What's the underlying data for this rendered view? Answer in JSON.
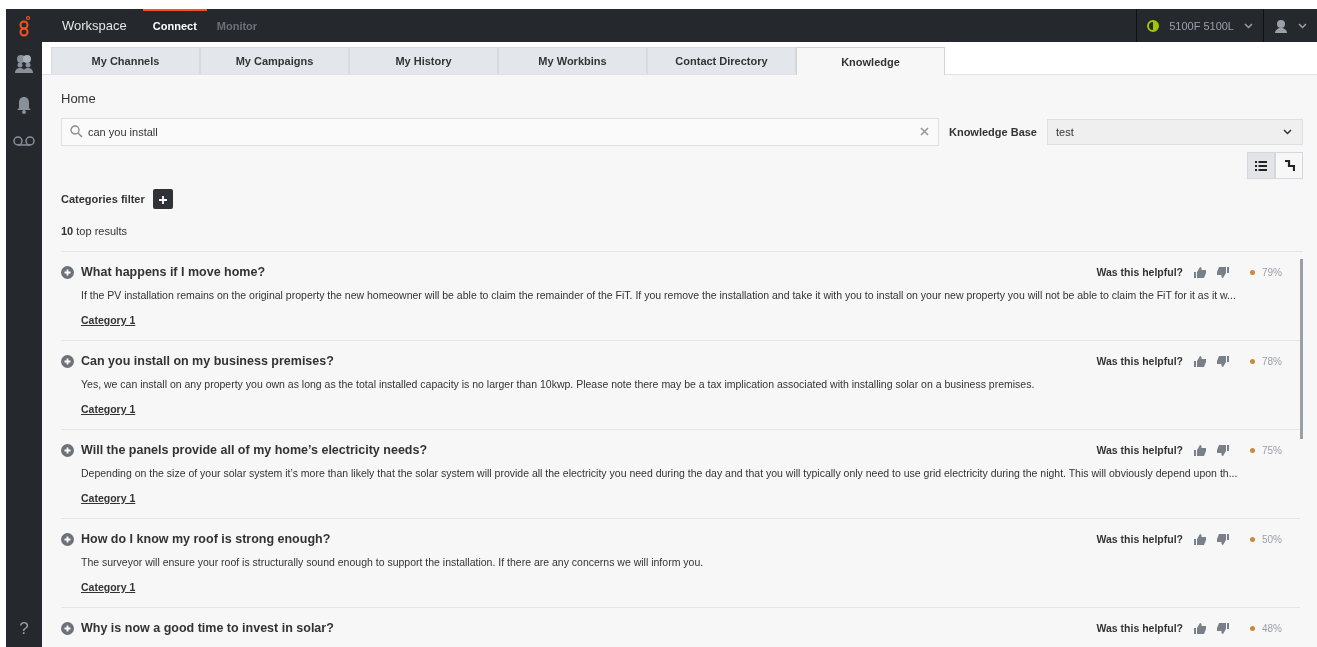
{
  "topbar": {
    "app": "Workspace",
    "nav": [
      {
        "label": "Connect",
        "selected": true
      },
      {
        "label": "Monitor",
        "selected": false
      }
    ],
    "user_status": "5100F 5100L"
  },
  "tabs": [
    {
      "label": "My Channels",
      "selected": false
    },
    {
      "label": "My Campaigns",
      "selected": false
    },
    {
      "label": "My History",
      "selected": false
    },
    {
      "label": "My Workbins",
      "selected": false
    },
    {
      "label": "Contact Directory",
      "selected": false
    },
    {
      "label": "Knowledge",
      "selected": true
    }
  ],
  "breadcrumb": "Home",
  "search": {
    "value": "can you install"
  },
  "knowledge_base": {
    "label": "Knowledge Base",
    "value": "test"
  },
  "view_toggle": [
    {
      "kind": "list",
      "selected": true
    },
    {
      "kind": "tree",
      "selected": false
    }
  ],
  "categories_filter": "Categories filter",
  "results_count": "**10** top results",
  "results": [
    {
      "title": "What happens if I move home?",
      "body": "If the PV installation remains on the original property the new homeowner will be able to claim the remainder of the FiT. If you remove the installation and take it with you to install on your new property you will not be able to claim the FiT for it as it w...",
      "category": "Category 1",
      "helpful": "Was this helpful?",
      "score": "79%"
    },
    {
      "title": "Can you install on my business premises?",
      "body": "Yes, we can install on any property you own as long as the total installed capacity is no larger than 10kwp. Please note there may be a tax implication associated with installing solar on a business premises.",
      "category": "Category 1",
      "helpful": "Was this helpful?",
      "score": "78%"
    },
    {
      "title": "Will the panels provide all of my home’s electricity needs?",
      "body": "Depending on the size of your solar system it’s more than likely that the solar system will provide all the electricity you need during the day and that you will typically only need to use grid electricity during the night. This will obviously depend upon th...",
      "category": "Category 1",
      "helpful": "Was this helpful?",
      "score": "75%"
    },
    {
      "title": "How do I know my roof is strong enough?",
      "body": "The surveyor will ensure your roof is structurally sound enough to support the installation. If there are any concerns we will inform you.",
      "category": "Category 1",
      "helpful": "Was this helpful?",
      "score": "50%"
    },
    {
      "title": "Why is now a good time to invest in solar?",
      "helpful": "Was this helpful?",
      "score": "48%"
    }
  ],
  "help": "?"
}
